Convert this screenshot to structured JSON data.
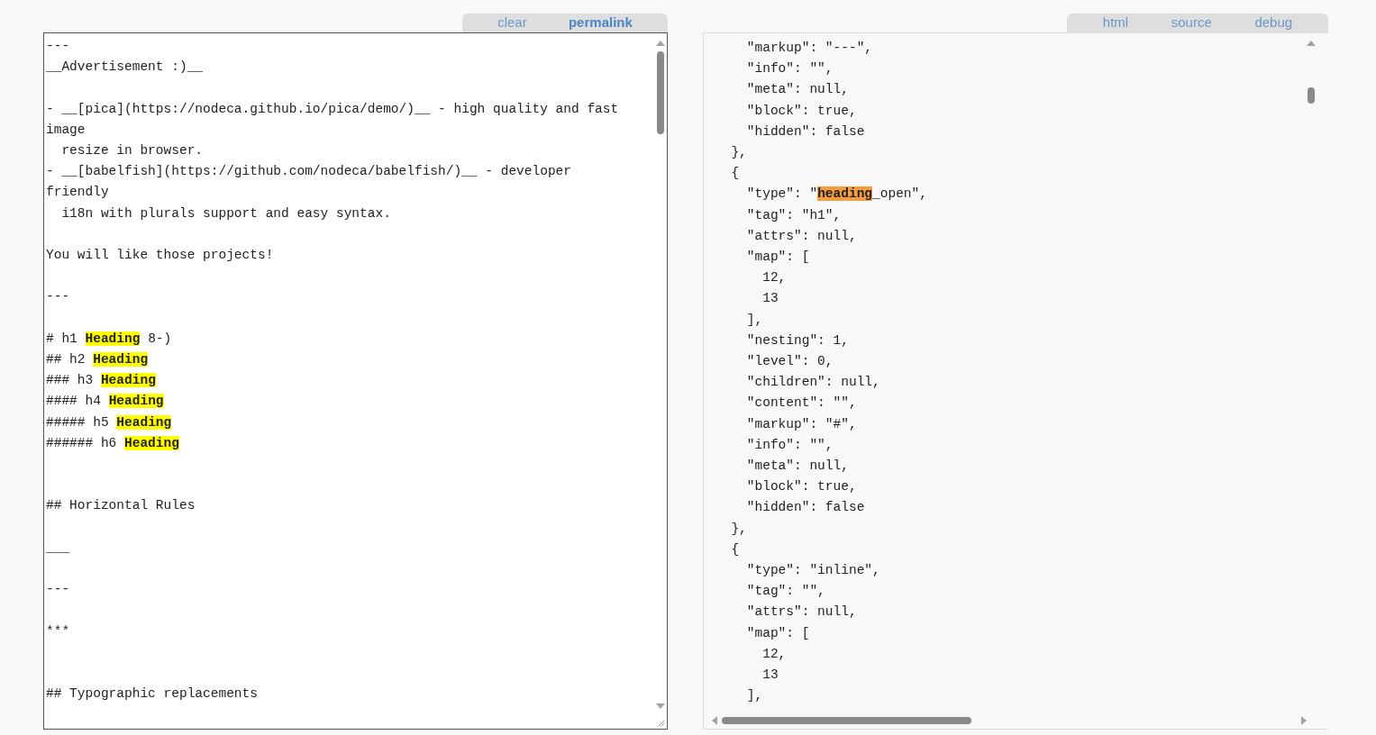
{
  "editor": {
    "toolbar": [
      {
        "label": "clear",
        "selected": false
      },
      {
        "label": "permalink",
        "selected": true
      }
    ],
    "lines": [
      {
        "text": "---"
      },
      {
        "text": "__Advertisement :)__"
      },
      {
        "kind": "blank"
      },
      {
        "text": "- __[pica](https://nodeca.github.io/pica/demo/)__ - high quality and fast"
      },
      {
        "text": "image"
      },
      {
        "text": "  resize in browser."
      },
      {
        "text": "- __[babelfish](https://github.com/nodeca/babelfish/)__ - developer"
      },
      {
        "text": "friendly"
      },
      {
        "text": "  i18n with plurals support and easy syntax."
      },
      {
        "kind": "blank"
      },
      {
        "text": "You will like those projects!"
      },
      {
        "kind": "blank"
      },
      {
        "text": "---"
      },
      {
        "kind": "blank"
      },
      {
        "text": "# h1 ",
        "match": "Heading",
        "after": " 8-)"
      },
      {
        "text": "## h2 ",
        "match": "Heading"
      },
      {
        "text": "### h3 ",
        "match": "Heading"
      },
      {
        "text": "#### h4 ",
        "match": "Heading"
      },
      {
        "text": "##### h5 ",
        "match": "Heading"
      },
      {
        "text": "###### h6 ",
        "match": "Heading"
      },
      {
        "kind": "blank"
      },
      {
        "kind": "blank"
      },
      {
        "text": "## Horizontal Rules"
      },
      {
        "kind": "blank"
      },
      {
        "text": "___"
      },
      {
        "kind": "blank"
      },
      {
        "text": "---"
      },
      {
        "kind": "blank"
      },
      {
        "text": "***"
      },
      {
        "kind": "blank"
      },
      {
        "kind": "blank"
      },
      {
        "text": "## Typographic replacements"
      }
    ]
  },
  "output": {
    "tabs": [
      {
        "label": "html"
      },
      {
        "label": "source"
      },
      {
        "label": "debug"
      }
    ],
    "lines": [
      {
        "text": "    \"markup\": \"---\","
      },
      {
        "text": "    \"info\": \"\","
      },
      {
        "text": "    \"meta\": null,"
      },
      {
        "text": "    \"block\": true,"
      },
      {
        "text": "    \"hidden\": false"
      },
      {
        "text": "  },"
      },
      {
        "text": "  {"
      },
      {
        "text": "    \"type\": \"",
        "match": "heading",
        "after": "_open\","
      },
      {
        "text": "    \"tag\": \"h1\","
      },
      {
        "text": "    \"attrs\": null,"
      },
      {
        "text": "    \"map\": ["
      },
      {
        "text": "      12,"
      },
      {
        "text": "      13"
      },
      {
        "text": "    ],"
      },
      {
        "text": "    \"nesting\": 1,"
      },
      {
        "text": "    \"level\": 0,"
      },
      {
        "text": "    \"children\": null,"
      },
      {
        "text": "    \"content\": \"\","
      },
      {
        "text": "    \"markup\": \"#\","
      },
      {
        "text": "    \"info\": \"\","
      },
      {
        "text": "    \"meta\": null,"
      },
      {
        "text": "    \"block\": true,"
      },
      {
        "text": "    \"hidden\": false"
      },
      {
        "text": "  },"
      },
      {
        "text": "  {"
      },
      {
        "text": "    \"type\": \"inline\","
      },
      {
        "text": "    \"tag\": \"\","
      },
      {
        "text": "    \"attrs\": null,"
      },
      {
        "text": "    \"map\": ["
      },
      {
        "text": "      12,"
      },
      {
        "text": "      13"
      },
      {
        "text": "    ],"
      }
    ]
  }
}
